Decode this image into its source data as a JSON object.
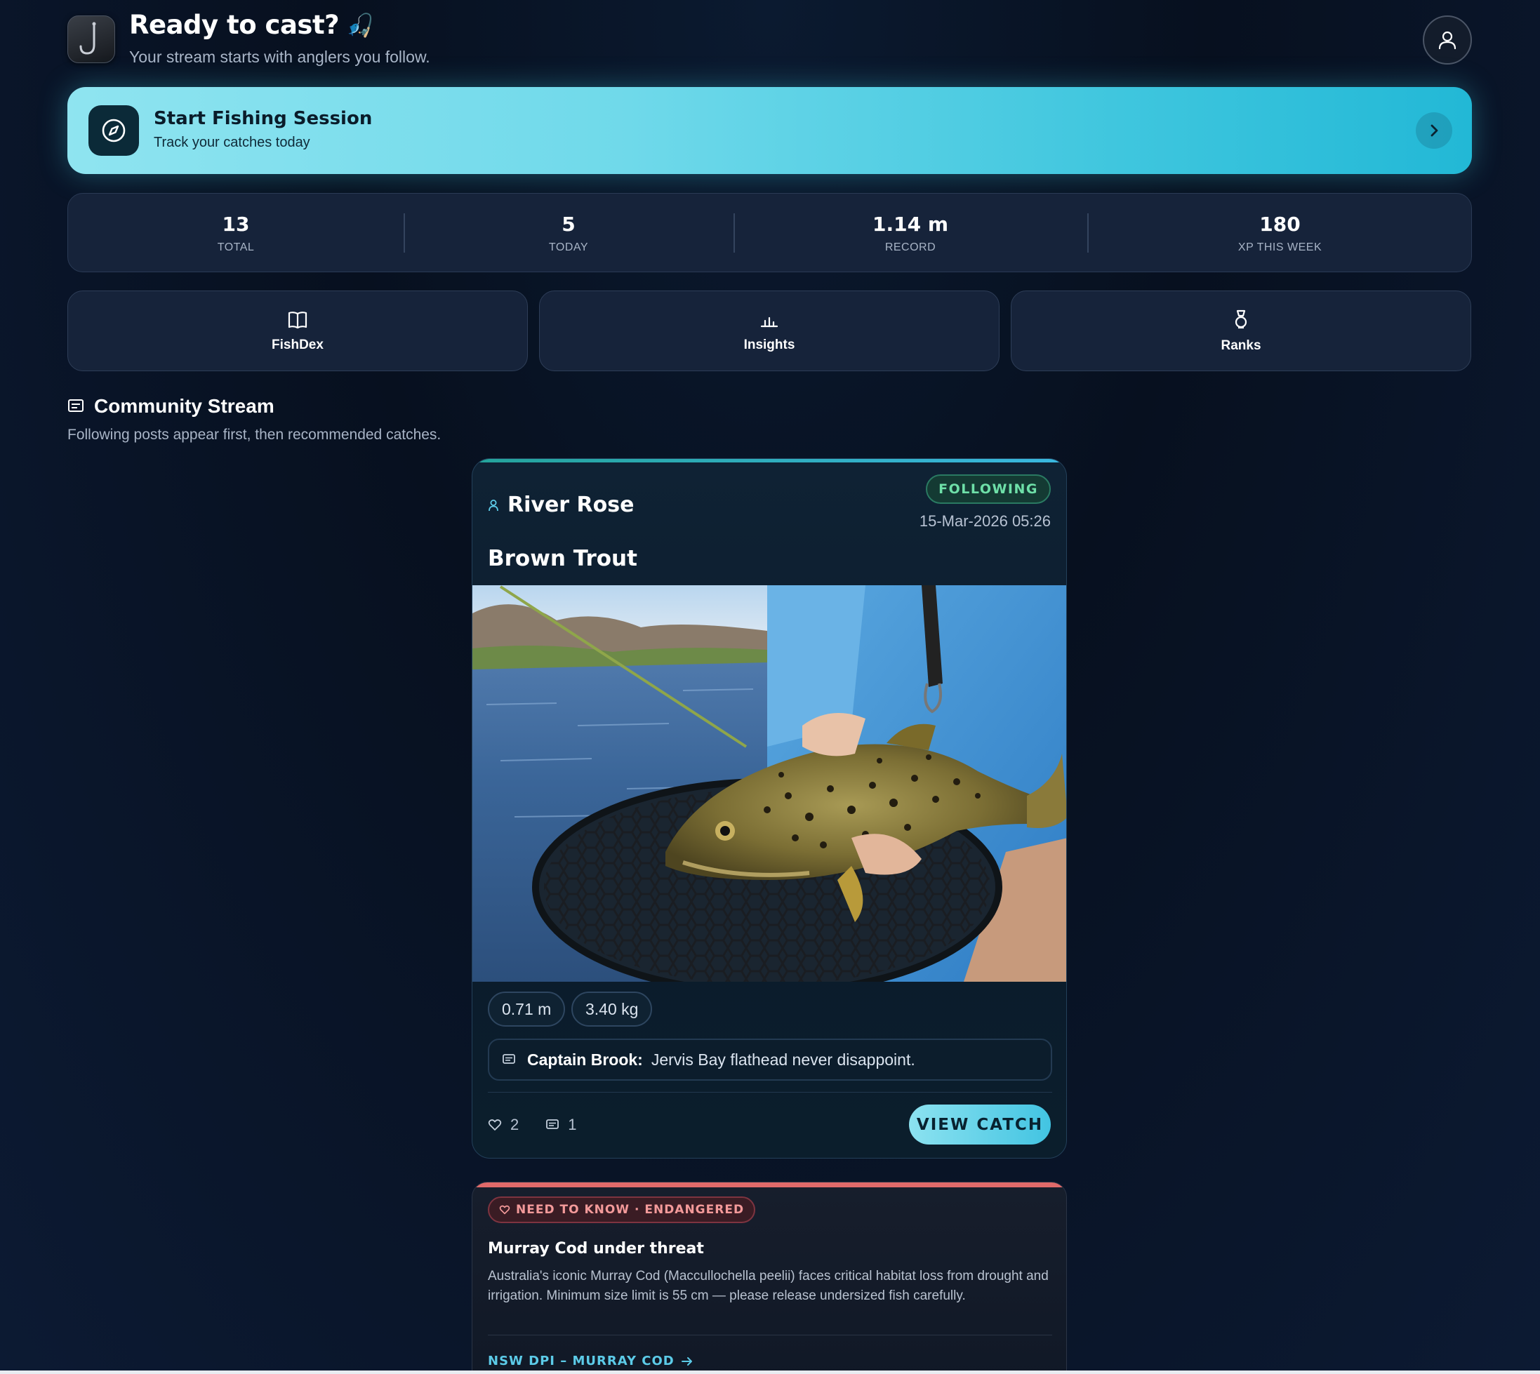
{
  "header": {
    "greeting": "Ready to cast?",
    "greeting_emoji": "🎣",
    "subtitle": "Your stream starts with anglers you follow."
  },
  "session": {
    "title": "Start Fishing Session",
    "subtitle": "Track your catches today"
  },
  "stats": [
    {
      "value": "13",
      "label": "TOTAL"
    },
    {
      "value": "5",
      "label": "TODAY"
    },
    {
      "value": "1.14 m",
      "label": "RECORD"
    },
    {
      "value": "180",
      "label": "XP THIS WEEK"
    }
  ],
  "quick_actions": [
    {
      "label": "FishDex",
      "icon": "book-icon"
    },
    {
      "label": "Insights",
      "icon": "bar-chart-icon"
    },
    {
      "label": "Ranks",
      "icon": "medal-icon"
    }
  ],
  "stream": {
    "title": "Community Stream",
    "subtitle": "Following posts appear first, then recommended catches."
  },
  "post": {
    "user": "River Rose",
    "badge": "FOLLOWING",
    "time": "15-Mar-2026 05:26",
    "species": "Brown Trout",
    "length": "0.71 m",
    "weight": "3.40 kg",
    "comment_author": "Captain Brook:",
    "comment_text": "Jervis Bay flathead never disappoint.",
    "likes": "2",
    "comments": "1",
    "cta": "VIEW CATCH"
  },
  "alert": {
    "badge": "NEED TO KNOW · ENDANGERED",
    "title": "Murray Cod under threat",
    "body": "Australia's iconic Murray Cod (Maccullochella peelii) faces critical habitat loss from drought and irrigation. Minimum size limit is 55 cm — please release undersized fish carefully.",
    "link": "NSW DPI – MURRAY COD"
  },
  "colors": {
    "accent_cyan": "#42c4e2",
    "following_green": "#6ee0a8",
    "alert_red": "#e06a6a",
    "background": "#0a1428"
  }
}
